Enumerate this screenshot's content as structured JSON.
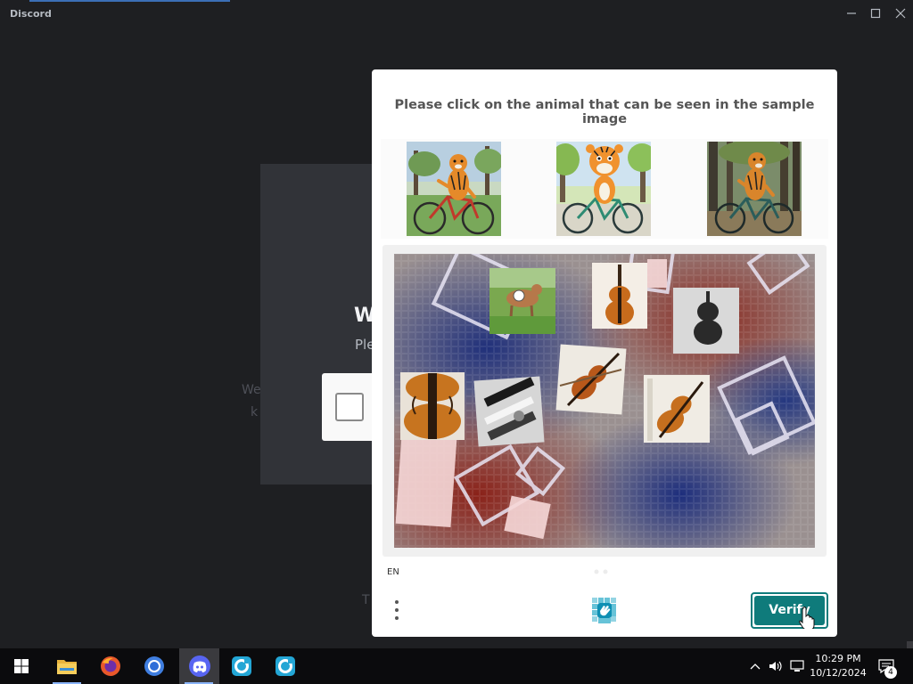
{
  "window": {
    "title": "Discord",
    "minimize_icon": "minimize-icon",
    "maximize_icon": "maximize-icon",
    "close_icon": "close-icon"
  },
  "background": {
    "title_fragment": "W",
    "subtitle_fragment": "Ple",
    "faint_left_1": "We",
    "faint_left_2": "k",
    "faint_left_3": "T"
  },
  "captcha": {
    "prompt": "Please click on the animal that can be seen in the sample image",
    "samples": [
      {
        "name": "tiger riding red bicycle in park"
      },
      {
        "name": "cartoon tiger riding green bicycle"
      },
      {
        "name": "tiger riding bicycle in forest"
      }
    ],
    "board_items": [
      {
        "name": "deer in grass"
      },
      {
        "name": "violin"
      },
      {
        "name": "violin silhouette"
      },
      {
        "name": "violin body"
      },
      {
        "name": "piano keys"
      },
      {
        "name": "violin with bow"
      },
      {
        "name": "violin on stand"
      }
    ],
    "language": "EN",
    "menu_icon": "more-vertical-icon",
    "logo_icon": "hcaptcha-logo-icon",
    "verify_label": "Verify",
    "accent_color": "#0f7b7b"
  },
  "taskbar": {
    "apps": [
      {
        "name": "windows-start-icon"
      },
      {
        "name": "file-explorer-icon"
      },
      {
        "name": "firefox-icon"
      },
      {
        "name": "chrome-icon"
      },
      {
        "name": "discord-icon"
      },
      {
        "name": "app-icon"
      },
      {
        "name": "app-icon"
      }
    ],
    "time": "10:29 PM",
    "date": "10/12/2024",
    "notification_count": "4"
  }
}
